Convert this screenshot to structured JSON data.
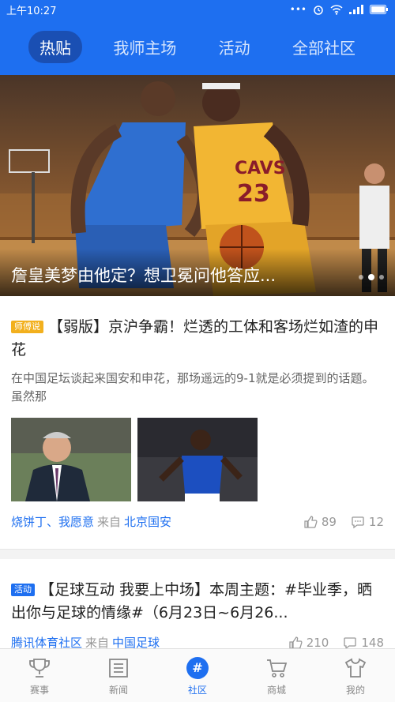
{
  "status_bar": {
    "time": "上午10:27",
    "dots": "•••"
  },
  "top_tabs": [
    {
      "label": "热贴",
      "active": true
    },
    {
      "label": "我师主场",
      "active": false
    },
    {
      "label": "活动",
      "active": false
    },
    {
      "label": "全部社区",
      "active": false
    }
  ],
  "banner": {
    "title": "詹皇美梦由他定？想卫冕问他答应...",
    "dot_count": 3,
    "active_dot": 1
  },
  "posts": [
    {
      "badge": "师傅说",
      "title": "【弱版】京沪争霸！烂透的工体和客场烂如渣的申花",
      "desc": "在中国足坛谈起来国安和申花，那场遥远的9-1就是必须提到的话题。虽然那",
      "authors": "烧饼丁、我愿意",
      "from": "来自",
      "source": "北京国安",
      "likes": "89",
      "comments": "12"
    },
    {
      "badge": "活动",
      "title": "【足球互动 我要上中场】本周主题：#毕业季，晒出你与足球的情缘#（6月23日~6月26...",
      "authors": "腾讯体育社区",
      "from": "来自",
      "source": "中国足球",
      "likes": "210",
      "comments": "148"
    }
  ],
  "bottom_nav": [
    {
      "label": "赛事",
      "icon": "trophy-icon",
      "active": false
    },
    {
      "label": "新闻",
      "icon": "news-icon",
      "active": false
    },
    {
      "label": "社区",
      "icon": "hash-icon",
      "active": true,
      "glyph": "#"
    },
    {
      "label": "商城",
      "icon": "cart-icon",
      "active": false
    },
    {
      "label": "我的",
      "icon": "shirt-icon",
      "active": false
    }
  ],
  "colors": {
    "primary": "#1e6ff0",
    "badge_yellow": "#f2b01e",
    "muted": "#999999"
  }
}
